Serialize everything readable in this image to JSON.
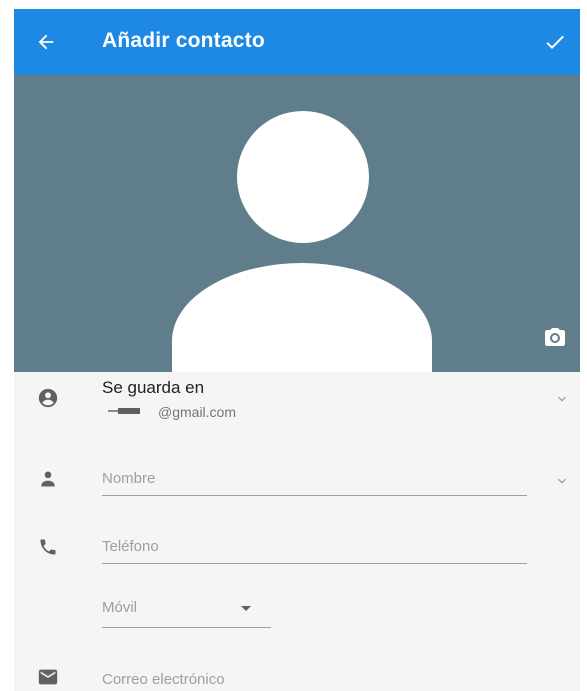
{
  "appbar": {
    "title": "Añadir contacto",
    "back_icon": "arrow-back-icon",
    "save_icon": "check-icon"
  },
  "photo": {
    "avatar_icon": "person-silhouette",
    "camera_icon": "camera-icon"
  },
  "account": {
    "label": "Se guarda en",
    "email": "@gmail.com",
    "icon": "account-circle-icon"
  },
  "form": {
    "name_placeholder": "Nombre",
    "phone_placeholder": "Teléfono",
    "phone_type": "Móvil",
    "email_placeholder": "Correo electrónico"
  },
  "colors": {
    "appbar": "#1e88e5",
    "photo_background": "#607d8b",
    "surface": "#f5f5f5"
  }
}
